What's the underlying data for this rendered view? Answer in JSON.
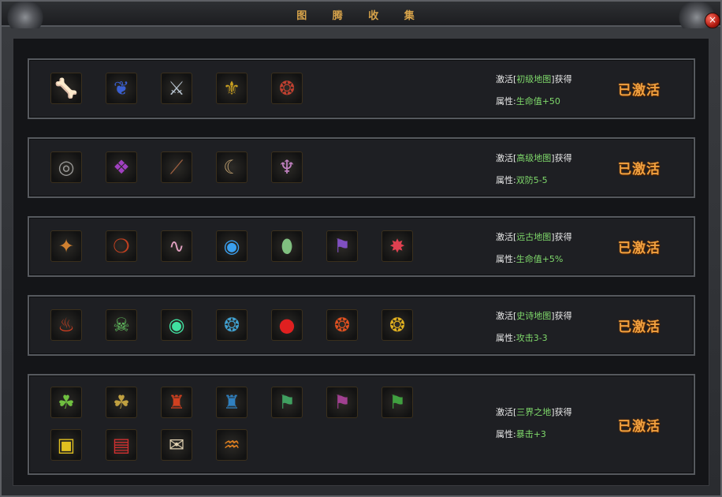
{
  "window": {
    "title": "图 腾 收 集",
    "close_label": "×"
  },
  "rows": [
    {
      "map_prefix": "激活[",
      "map_name": "初级地图",
      "map_suffix": "]获得",
      "attr_label": "属性:",
      "attr_value": "生命值+50",
      "status": "已激活",
      "icons": [
        {
          "name": "bone-icon",
          "glyph": "🦴",
          "color": "#e0c8b8"
        },
        {
          "name": "blue-claw-icon",
          "glyph": "❦",
          "color": "#3a5fd0"
        },
        {
          "name": "silver-claw-icon",
          "glyph": "⚔",
          "color": "#b8c4d0"
        },
        {
          "name": "golden-armor-icon",
          "glyph": "⚜",
          "color": "#c9a020"
        },
        {
          "name": "red-leaf-icon",
          "glyph": "❂",
          "color": "#c04030"
        }
      ]
    },
    {
      "map_prefix": "激活[",
      "map_name": "高级地图",
      "map_suffix": "]获得",
      "attr_label": "属性:",
      "attr_value": "双防5-5",
      "status": "已激活",
      "icons": [
        {
          "name": "stone-ring-icon",
          "glyph": "◎",
          "color": "#9a9a98"
        },
        {
          "name": "purple-scroll-icon",
          "glyph": "❖",
          "color": "#a040c0"
        },
        {
          "name": "wooden-staff-icon",
          "glyph": "⟋",
          "color": "#a06040"
        },
        {
          "name": "horn-icon",
          "glyph": "☾",
          "color": "#c0a070"
        },
        {
          "name": "fangs-icon",
          "glyph": "♆",
          "color": "#c080c0"
        }
      ]
    },
    {
      "map_prefix": "激活[",
      "map_name": "远古地图",
      "map_suffix": "]获得",
      "attr_label": "属性:",
      "attr_value": "生命值+5%",
      "status": "已激活",
      "icons": [
        {
          "name": "golden-scroll-icon",
          "glyph": "✦",
          "color": "#d08030"
        },
        {
          "name": "red-necklace-icon",
          "glyph": "❍",
          "color": "#c04020"
        },
        {
          "name": "pink-worm-icon",
          "glyph": "∿",
          "color": "#e0a0c0"
        },
        {
          "name": "blue-dragon-orb-icon",
          "glyph": "◉",
          "color": "#3aa0f0"
        },
        {
          "name": "jeweled-egg-icon",
          "glyph": "⬮",
          "color": "#80c080"
        },
        {
          "name": "purple-banner-icon",
          "glyph": "⚑",
          "color": "#8050c0"
        },
        {
          "name": "red-star-icon",
          "glyph": "✸",
          "color": "#e04050"
        }
      ]
    },
    {
      "map_prefix": "激活[",
      "map_name": "史诗地图",
      "map_suffix": "]获得",
      "attr_label": "属性:",
      "attr_value": "攻击3-3",
      "status": "已激活",
      "icons": [
        {
          "name": "fire-crest-icon",
          "glyph": "♨",
          "color": "#e04020"
        },
        {
          "name": "demon-mask-icon",
          "glyph": "☠",
          "color": "#60c060"
        },
        {
          "name": "green-orb-icon",
          "glyph": "◉",
          "color": "#40e0a0"
        },
        {
          "name": "blue-dragon-coin-icon",
          "glyph": "❂",
          "color": "#40a0d0"
        },
        {
          "name": "red-orb-icon",
          "glyph": "●",
          "color": "#e02020"
        },
        {
          "name": "red-dragon-coin-icon",
          "glyph": "❂",
          "color": "#e05020"
        },
        {
          "name": "gold-lion-coin-icon",
          "glyph": "❂",
          "color": "#e0b020"
        }
      ]
    },
    {
      "map_prefix": "激活[",
      "map_name": "三界之地",
      "map_suffix": "]获得",
      "attr_label": "属性:",
      "attr_value": "暴击+3",
      "status": "已激活",
      "icons": [
        {
          "name": "green-jade-icon",
          "glyph": "☘",
          "color": "#70c040"
        },
        {
          "name": "gold-jade-icon",
          "glyph": "☘",
          "color": "#c0a040"
        },
        {
          "name": "red-seal-icon",
          "glyph": "♜",
          "color": "#d04020"
        },
        {
          "name": "blue-seal-icon",
          "glyph": "♜",
          "color": "#3080c0"
        },
        {
          "name": "green-flag-icon",
          "glyph": "⚑",
          "color": "#40a060"
        },
        {
          "name": "purple-flag-icon",
          "glyph": "⚑",
          "color": "#a04090"
        },
        {
          "name": "green-book-icon",
          "glyph": "⚑",
          "color": "#40a040"
        },
        {
          "name": "gold-box-icon",
          "glyph": "▣",
          "color": "#e0c020"
        },
        {
          "name": "red-book-icon",
          "glyph": "▤",
          "color": "#d03030"
        },
        {
          "name": "paper-scroll-icon",
          "glyph": "✉",
          "color": "#e0d0b0"
        },
        {
          "name": "twin-dragon-icon",
          "glyph": "♒",
          "color": "#e08020"
        }
      ]
    }
  ]
}
